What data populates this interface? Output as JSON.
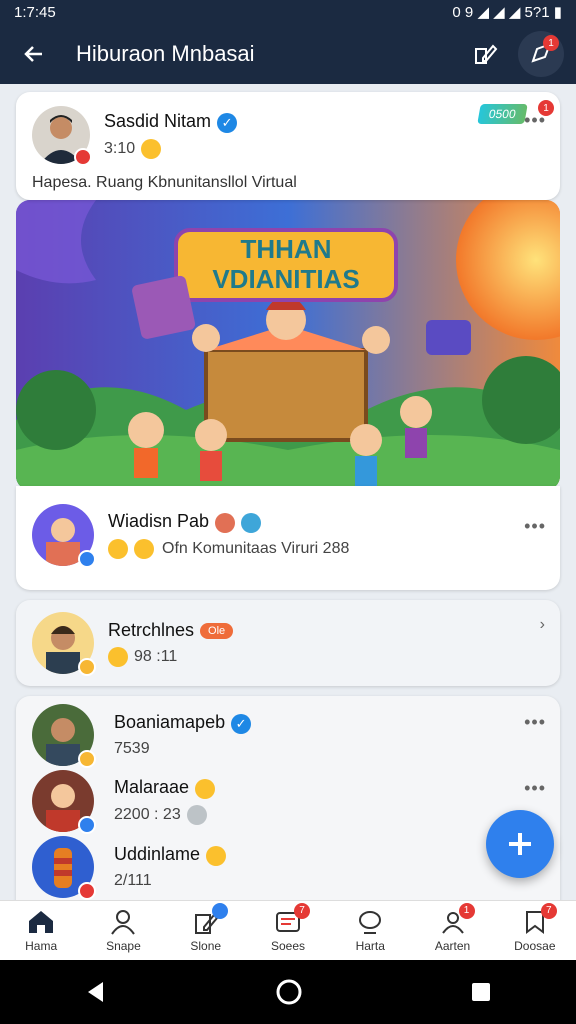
{
  "status": {
    "time": "1:7:45",
    "right": "0  9  ◢  ◢  ◢  5?1  ▮"
  },
  "app": {
    "title": "Hiburaon Mnbasai",
    "notif_count": "1"
  },
  "post": {
    "name": "Sasdid Nitam",
    "sub": "3:10",
    "desc": "Hapesa. Ruang Kbnunitansllol Virtual",
    "tag": "0500",
    "badge": "1"
  },
  "banner": {
    "title_line1": "THHAN",
    "title_line2": "VDIANITIAS"
  },
  "event": {
    "name": "Wiadisn Pab",
    "sub": "Ofn Komunitaas Viruri 288"
  },
  "grey_item": {
    "name": "Retrchlnes",
    "tag": "Ole",
    "sub": "98 :11"
  },
  "list": [
    {
      "name": "Boaniamapeb",
      "sub": "7539"
    },
    {
      "name": "Malaraae",
      "sub": "2200 : 23"
    },
    {
      "name": "Uddinlame",
      "sub": "2/111"
    }
  ],
  "nav": [
    {
      "label": "Hama",
      "icon": "home-icon",
      "badge": ""
    },
    {
      "label": "Snape",
      "icon": "profile-icon",
      "badge": ""
    },
    {
      "label": "Slone",
      "icon": "edit-icon",
      "badge": ""
    },
    {
      "label": "Soees",
      "icon": "inbox-icon",
      "badge": "7"
    },
    {
      "label": "Harta",
      "icon": "chat-icon",
      "badge": ""
    },
    {
      "label": "Aarten",
      "icon": "people-icon",
      "badge": "1"
    },
    {
      "label": "Doosae",
      "icon": "bookmark-icon",
      "badge": "7"
    }
  ],
  "colors": {
    "appbar": "#1b2a41",
    "accent": "#2f80ed",
    "badge": "#e53935"
  }
}
